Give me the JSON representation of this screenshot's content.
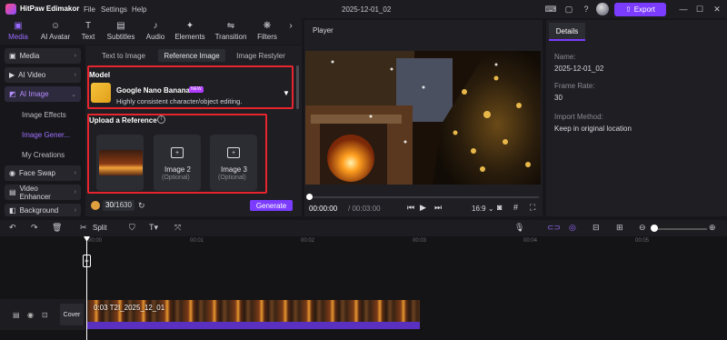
{
  "app": {
    "name": "HitPaw Edimakor",
    "project_title": "2025-12-01_02",
    "export_label": "Export"
  },
  "menu": [
    "File",
    "Settings",
    "Help"
  ],
  "toolbar": {
    "tabs": [
      {
        "label": "Media",
        "icon": "media-icon"
      },
      {
        "label": "AI Avatar",
        "icon": "avatar-icon"
      },
      {
        "label": "Text",
        "icon": "text-icon"
      },
      {
        "label": "Subtitles",
        "icon": "subtitles-icon"
      },
      {
        "label": "Audio",
        "icon": "audio-icon"
      },
      {
        "label": "Elements",
        "icon": "elements-icon"
      },
      {
        "label": "Transition",
        "icon": "transition-icon"
      },
      {
        "label": "Filters",
        "icon": "filters-icon"
      }
    ]
  },
  "sidebar": {
    "items": [
      {
        "label": "Media"
      },
      {
        "label": "AI Video"
      },
      {
        "label": "AI Image"
      },
      {
        "label": "Face Swap"
      },
      {
        "label": "Video Enhancer"
      },
      {
        "label": "Background"
      }
    ],
    "subitems": [
      {
        "label": "Image Effects"
      },
      {
        "label": "Image Gener..."
      },
      {
        "label": "My Creations"
      }
    ]
  },
  "panel": {
    "tabs": [
      "Text to Image",
      "Reference Image",
      "Image Restyler"
    ],
    "model_label": "Model",
    "model_name": "Google Nano Banana",
    "model_badge": "NEW",
    "model_desc": "Highly consistent character/object editing.",
    "upload_label": "Upload a Reference",
    "slots": [
      {
        "name": "Image 2",
        "optional": "(Optional)"
      },
      {
        "name": "Image 3",
        "optional": "(Optional)"
      }
    ],
    "credits_used": "30",
    "credits_total": "/1630",
    "generate_label": "Generate"
  },
  "player": {
    "label": "Player",
    "time_current": "00:00:00",
    "time_total": "/ 00:03:00",
    "ratio": "16:9"
  },
  "details": {
    "tab": "Details",
    "fields": [
      {
        "label": "Name:",
        "value": "2025-12-01_02"
      },
      {
        "label": "Frame Rate:",
        "value": "30"
      },
      {
        "label": "Import Method:",
        "value": "Keep in original location"
      }
    ]
  },
  "timeline": {
    "split_label": "Split",
    "ticks": [
      "00:00",
      "00:01",
      "00:02",
      "00:03",
      "00:04",
      "00:05"
    ],
    "cover_label": "Cover",
    "clip_label": "0:03 T2I_2025_12_01"
  },
  "colors": {
    "accent": "#7b3cff",
    "highlight_border": "#e8242e"
  }
}
